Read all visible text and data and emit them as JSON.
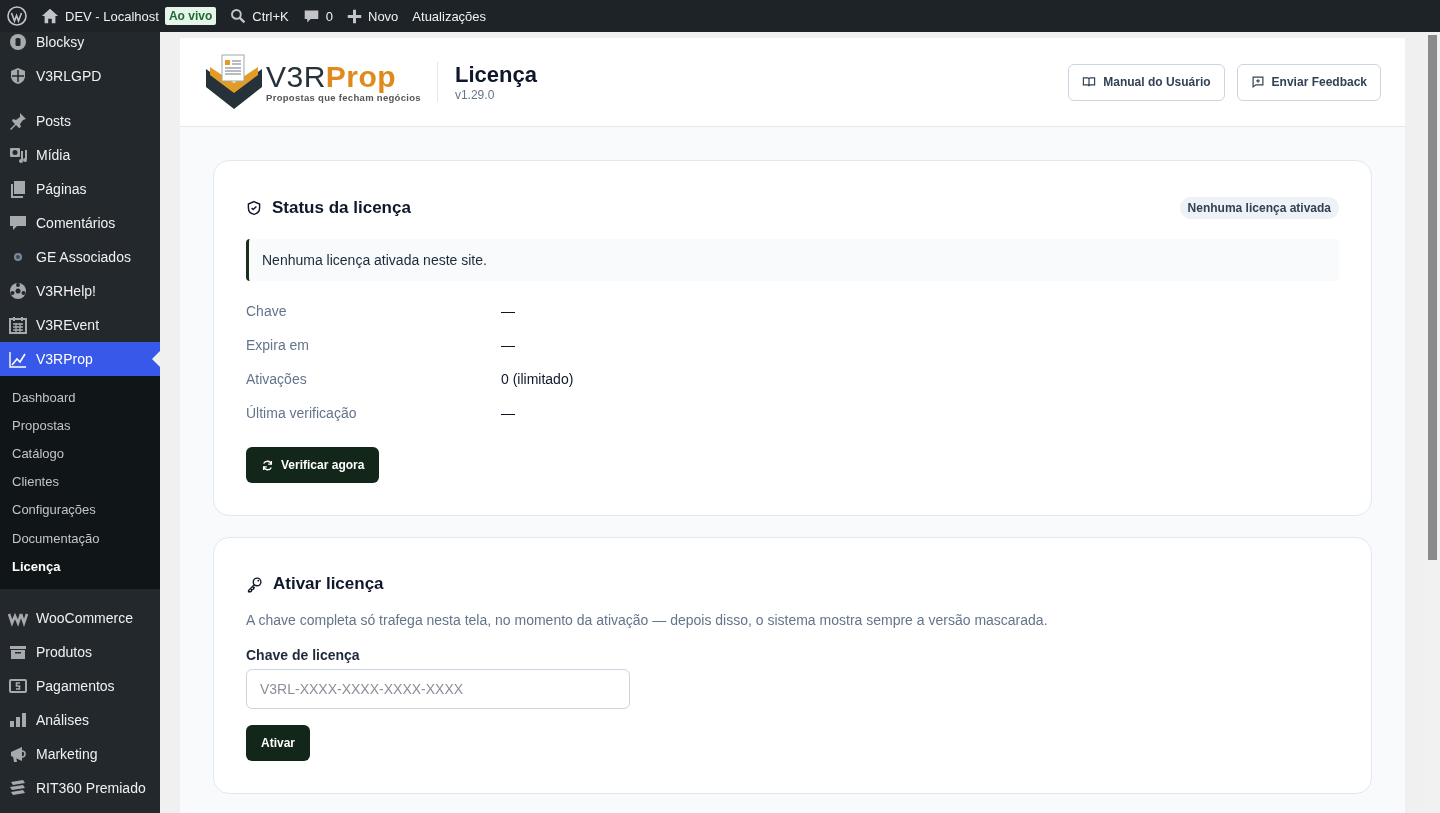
{
  "admin_bar": {
    "site": "DEV - Localhost",
    "live_badge": "Ao vivo",
    "search_shortcut": "Ctrl+K",
    "comments_count": "0",
    "new_label": "Novo",
    "updates_label": "Atualizações"
  },
  "sidebar": {
    "groups": [
      {
        "items": [
          {
            "label": "Blocksy",
            "selected": false
          },
          {
            "label": "V3RLGPD",
            "selected": false
          }
        ]
      },
      {
        "items": [
          {
            "label": "Posts",
            "selected": false
          },
          {
            "label": "Mídia",
            "selected": false
          },
          {
            "label": "Páginas",
            "selected": false
          },
          {
            "label": "Comentários",
            "selected": false
          },
          {
            "label": "GE Associados",
            "selected": false
          },
          {
            "label": "V3RHelp!",
            "selected": false
          },
          {
            "label": "V3REvent",
            "selected": false
          },
          {
            "label": "V3RProp",
            "selected": true,
            "submenu": [
              {
                "label": "Dashboard",
                "selected": false
              },
              {
                "label": "Propostas",
                "selected": false
              },
              {
                "label": "Catálogo",
                "selected": false
              },
              {
                "label": "Clientes",
                "selected": false
              },
              {
                "label": "Configurações",
                "selected": false
              },
              {
                "label": "Documentação",
                "selected": false
              },
              {
                "label": "Licença",
                "selected": true
              }
            ]
          }
        ]
      },
      {
        "items": [
          {
            "label": "WooCommerce",
            "selected": false
          },
          {
            "label": "Produtos",
            "selected": false
          },
          {
            "label": "Pagamentos",
            "selected": false
          },
          {
            "label": "Análises",
            "selected": false
          },
          {
            "label": "Marketing",
            "selected": false
          },
          {
            "label": "RIT360 Premiado",
            "selected": false
          }
        ]
      }
    ]
  },
  "header": {
    "wordmark": {
      "dark": "V3R",
      "accent": "Prop"
    },
    "tagline": "Propostas que fecham negócios",
    "title": "Licença",
    "version": "v1.29.0",
    "buttons": [
      "Manual do Usuário",
      "Enviar Feedback"
    ]
  },
  "status_card": {
    "title": "Status da licença",
    "badge": "Nenhuma licença ativada",
    "notice": "Nenhuma licença ativada neste site.",
    "fields": [
      {
        "label": "Chave",
        "value": "—"
      },
      {
        "label": "Expira em",
        "value": "—"
      },
      {
        "label": "Ativações",
        "value": "0 (ilimitado)"
      },
      {
        "label": "Última verificação",
        "value": "—"
      }
    ],
    "button": "Verificar agora"
  },
  "activate_card": {
    "title": "Ativar licença",
    "description": "A chave completa só trafega nesta tela, no momento da ativação — depois disso, o sistema mostra sempre a versão mascarada.",
    "field_label": "Chave de licença",
    "placeholder": "V3RL-XXXX-XXXX-XXXX-XXXX",
    "button": "Ativar"
  }
}
